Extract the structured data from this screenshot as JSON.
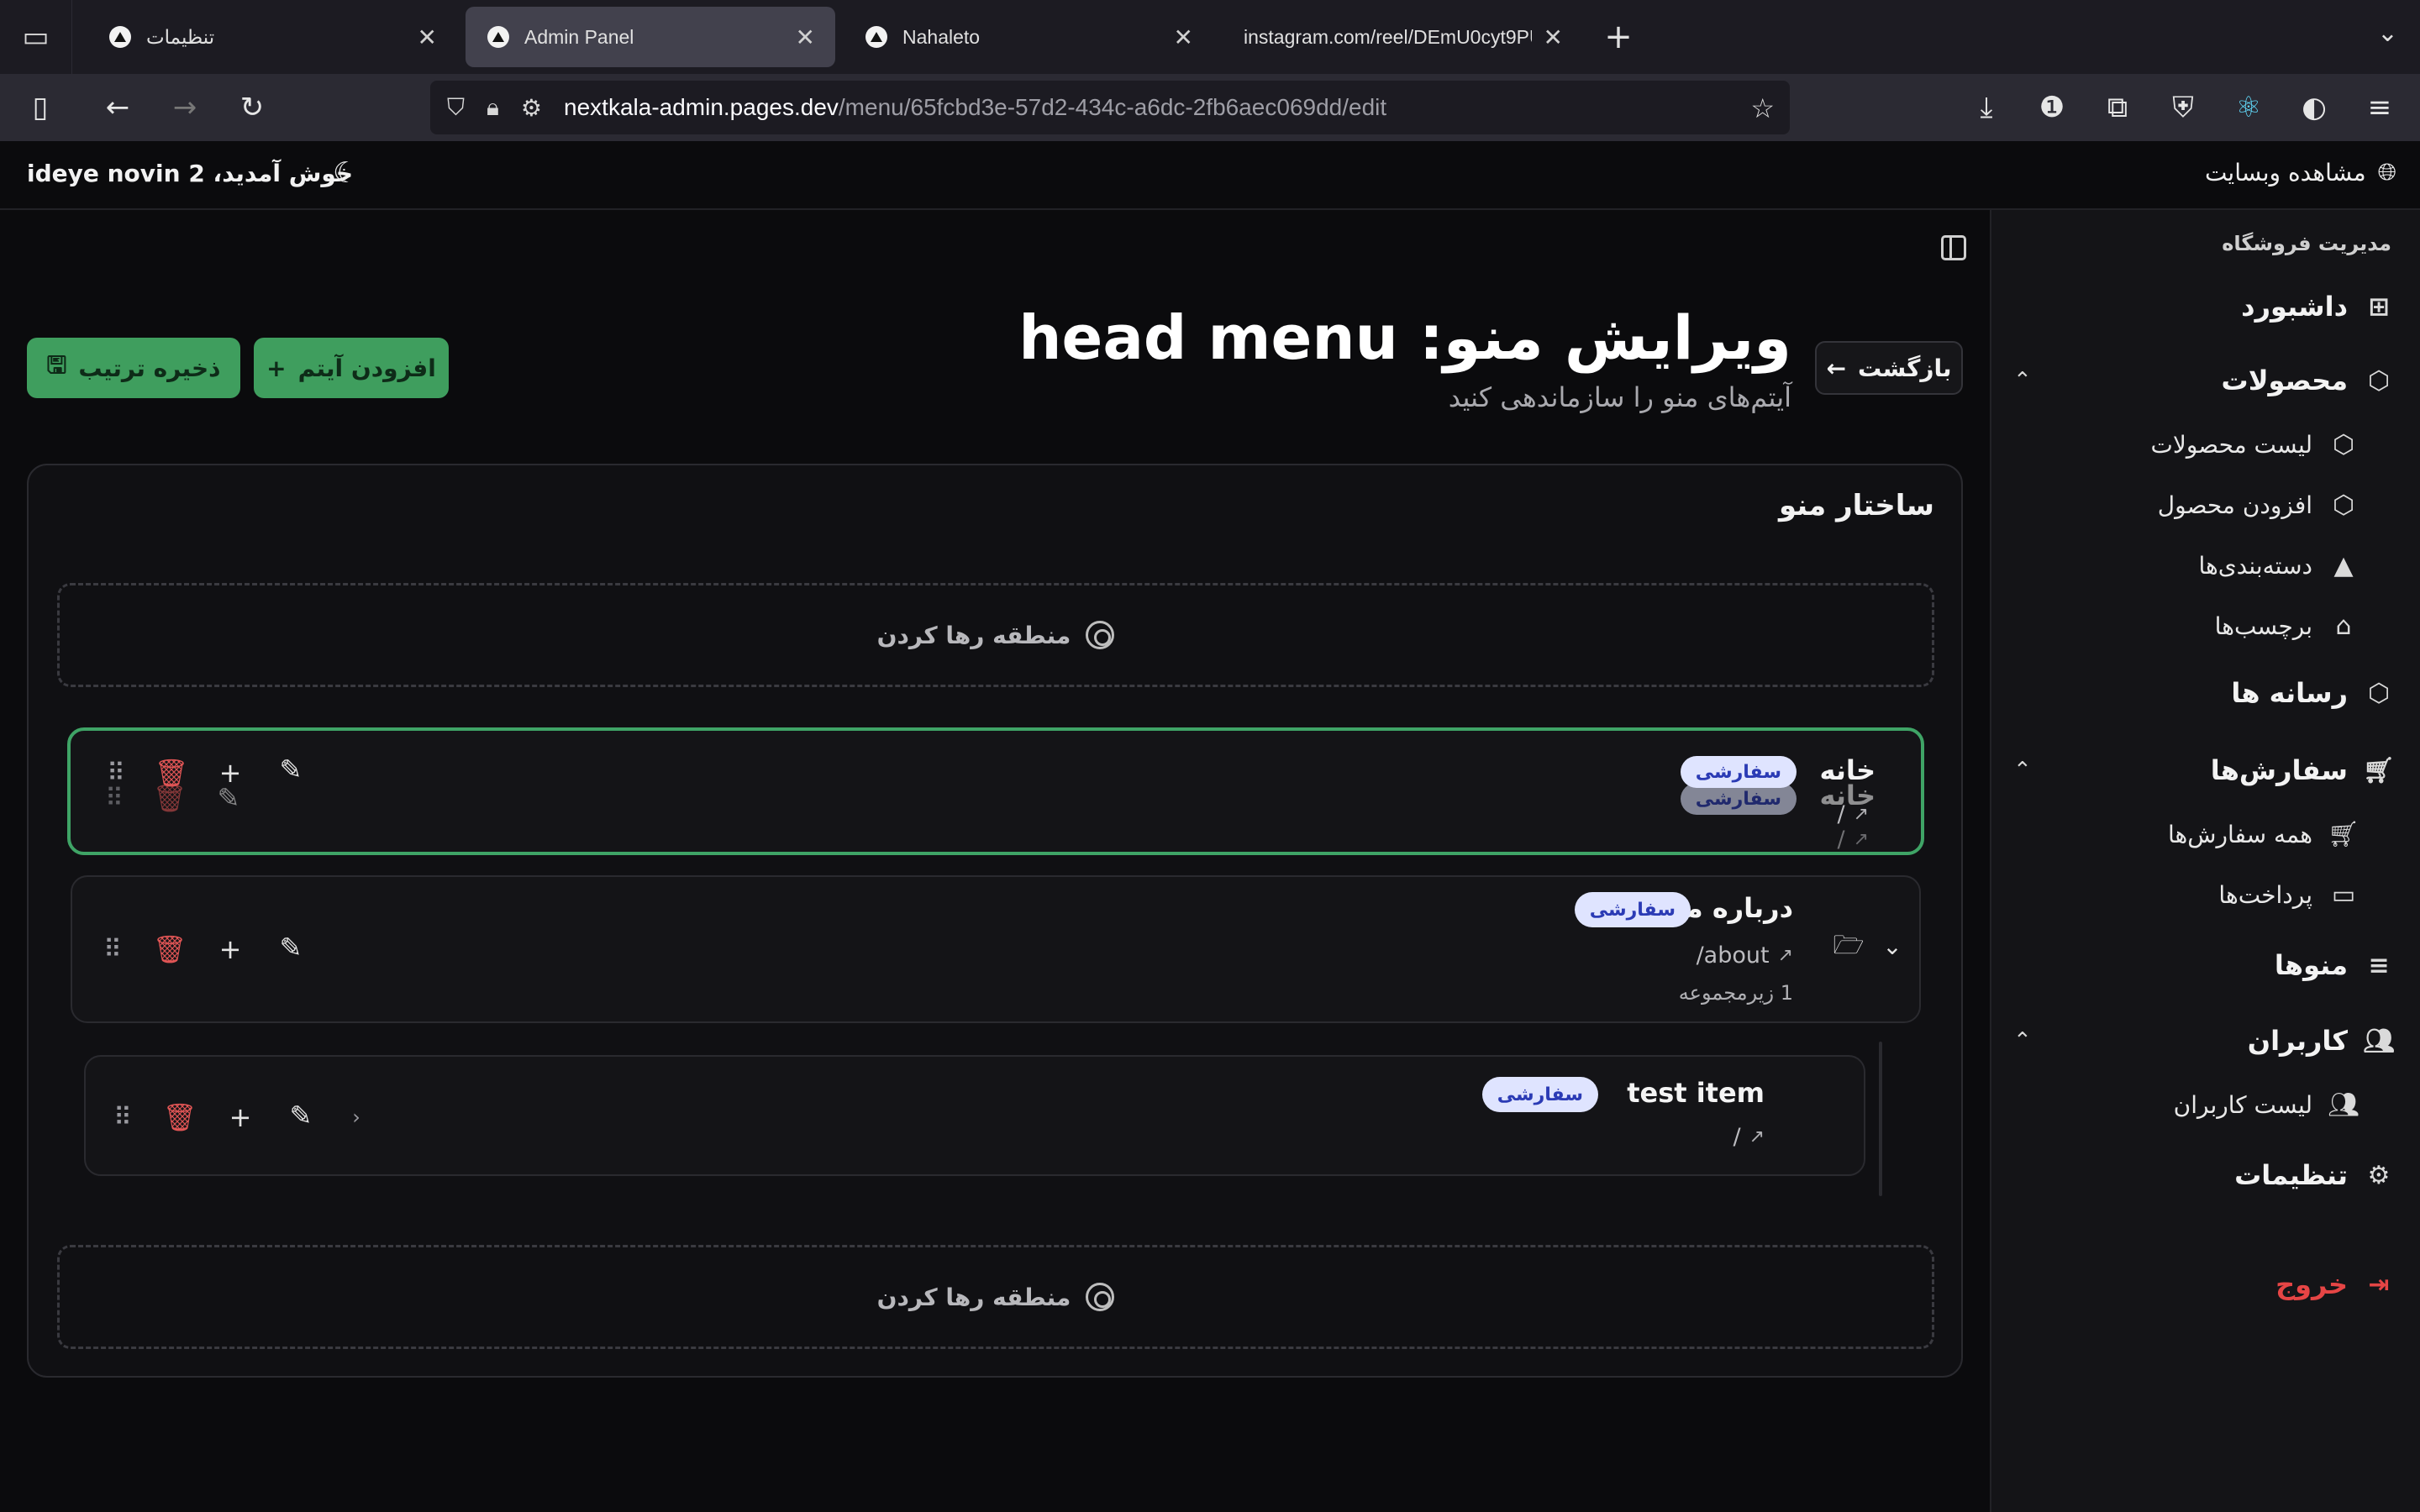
{
  "browser": {
    "tabs": [
      {
        "title": "تنظیمات",
        "active": false
      },
      {
        "title": "Admin Panel",
        "active": true
      },
      {
        "title": "Nahaleto",
        "active": false
      },
      {
        "title": "instagram.com/reel/DEmU0cyt9PU/?",
        "active": false
      }
    ],
    "url_host": "nextkala-admin.pages.dev",
    "url_path": "/menu/65fcbd3e-57d2-434c-a6dc-2fb6aec069dd/edit"
  },
  "header": {
    "welcome": "خوش آمدید، ideye novin 2",
    "view_site": "مشاهده وبسایت"
  },
  "sidebar": {
    "heading": "مدیریت فروشگاه",
    "dashboard": "داشبورد",
    "products": "محصولات",
    "product_list": "لیست محصولات",
    "add_product": "افزودن محصول",
    "categories": "دسته‌بندی‌ها",
    "tags": "برچسب‌ها",
    "media": "رسانه ها",
    "orders": "سفارش‌ها",
    "all_orders": "همه سفارش‌ها",
    "payments": "پرداخت‌ها",
    "menus": "منوها",
    "users": "کاربران",
    "user_list": "لیست کاربران",
    "settings": "تنظیمات",
    "logout": "خروج"
  },
  "page": {
    "title": "ویرایش منو: head menu",
    "subtitle": "آیتم‌های منو را سازماندهی کنید",
    "back": "بازگشت",
    "add_item": "افزودن آیتم",
    "save_order": "ذخیره ترتیب",
    "structure_title": "ساختار منو",
    "dropzone": "منطقه رها کردن"
  },
  "menu_items": {
    "home": {
      "title": "خانه",
      "badge": "سفارشی",
      "url": "/"
    },
    "about": {
      "title": "درباره ما",
      "badge": "سفارشی",
      "url": "/about",
      "children": "1 زیرمجموعه"
    },
    "test": {
      "title": "test item",
      "badge": "سفارشی",
      "url": "/"
    }
  },
  "colors": {
    "accent": "#3f9e5e",
    "danger": "#e05555",
    "badge_bg": "#dfe4ff"
  }
}
